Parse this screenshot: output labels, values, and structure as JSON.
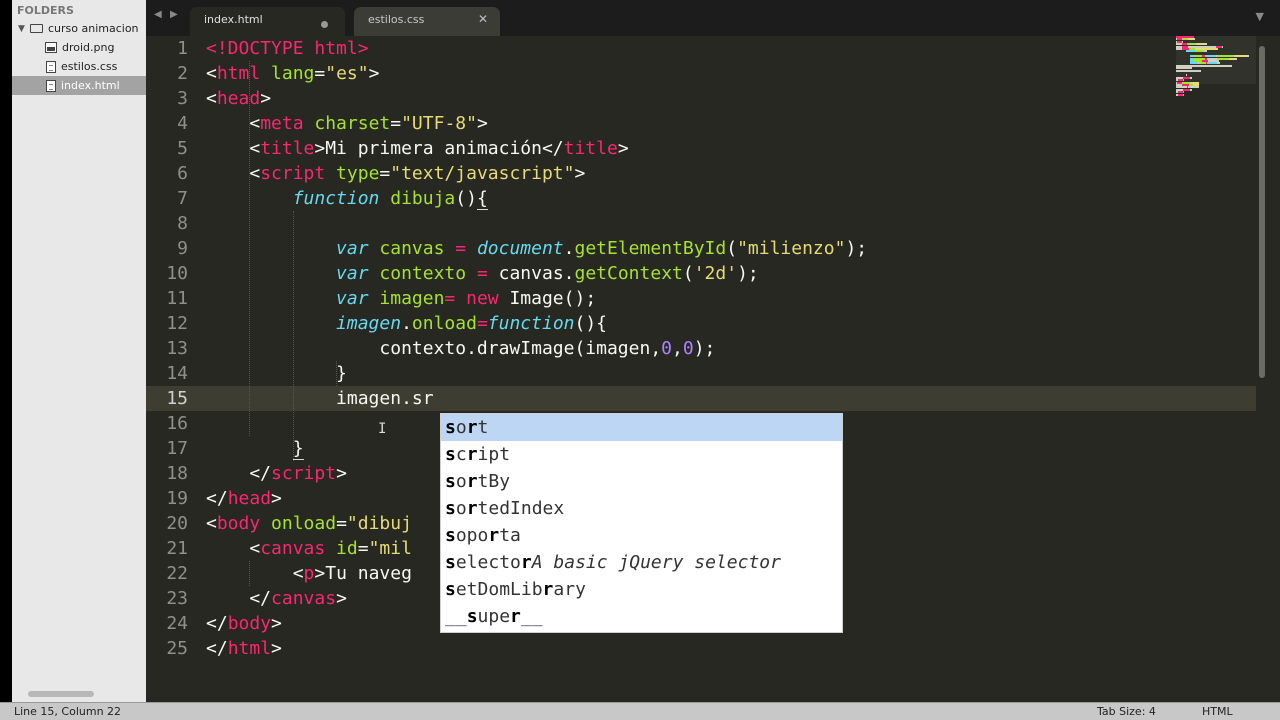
{
  "sidebar": {
    "header": "FOLDERS",
    "folder": {
      "name": "curso animacion",
      "icon": "folder-icon"
    },
    "files": [
      {
        "name": "droid.png",
        "icon": "image-file-icon",
        "selected": false
      },
      {
        "name": "estilos.css",
        "icon": "file-icon",
        "selected": false
      },
      {
        "name": "index.html",
        "icon": "file-icon",
        "selected": true
      }
    ]
  },
  "tabs": [
    {
      "label": "index.html",
      "active": true,
      "modified": true
    },
    {
      "label": "estilos.css",
      "active": false,
      "modified": false
    }
  ],
  "tabbar": {
    "nav_left_icon": "chevron-left-icon",
    "nav_right_icon": "chevron-right-icon",
    "menu_icon": "chevron-down-icon"
  },
  "editor": {
    "current_line": 15,
    "line_numbers": [
      "1",
      "2",
      "3",
      "4",
      "5",
      "6",
      "7",
      "8",
      "9",
      "10",
      "11",
      "12",
      "13",
      "14",
      "15",
      "16",
      "17",
      "18",
      "19",
      "20",
      "21",
      "22",
      "23",
      "24",
      "25"
    ],
    "lines": [
      [
        [
          "t-tag",
          "<!DOCTYPE html>"
        ]
      ],
      [
        [
          "",
          "<"
        ],
        [
          "t-tag",
          "html"
        ],
        [
          "t-attr",
          " lang"
        ],
        [
          "",
          "="
        ],
        [
          "t-str",
          "\"es\""
        ],
        [
          "",
          ">"
        ]
      ],
      [
        [
          "",
          "<"
        ],
        [
          "t-tag",
          "head"
        ],
        [
          "",
          ">"
        ]
      ],
      [
        [
          "",
          "    <"
        ],
        [
          "t-tag",
          "meta"
        ],
        [
          "t-attr",
          " charset"
        ],
        [
          "",
          "="
        ],
        [
          "t-str",
          "\"UTF-8\""
        ],
        [
          "",
          ">"
        ]
      ],
      [
        [
          "",
          "    <"
        ],
        [
          "t-tag",
          "title"
        ],
        [
          "",
          ">Mi primera animación</"
        ],
        [
          "t-tag",
          "title"
        ],
        [
          "",
          ">"
        ]
      ],
      [
        [
          "",
          "    <"
        ],
        [
          "t-tag",
          "script"
        ],
        [
          "t-attr",
          " type"
        ],
        [
          "",
          "="
        ],
        [
          "t-str",
          "\"text/javascript\""
        ],
        [
          "",
          ">"
        ]
      ],
      [
        [
          "",
          "        "
        ],
        [
          "t-kw",
          "function"
        ],
        [
          "t-fn",
          " dibuja"
        ],
        [
          "",
          "()"
        ],
        [
          "ul",
          "{"
        ]
      ],
      [
        [
          "",
          ""
        ]
      ],
      [
        [
          "",
          "            "
        ],
        [
          "t-kw",
          "var"
        ],
        [
          "t-fn",
          " canvas"
        ],
        [
          "t-kwn",
          " ="
        ],
        [
          "t-obj",
          " document"
        ],
        [
          "",
          "."
        ],
        [
          "t-fn",
          "getElementById"
        ],
        [
          "",
          "("
        ],
        [
          "t-str",
          "\"milienzo\""
        ],
        [
          "",
          ");"
        ]
      ],
      [
        [
          "",
          "            "
        ],
        [
          "t-kw",
          "var"
        ],
        [
          "t-fn",
          " contexto"
        ],
        [
          "t-kwn",
          " ="
        ],
        [
          "",
          " canvas."
        ],
        [
          "t-fn",
          "getContext"
        ],
        [
          "",
          "("
        ],
        [
          "t-str",
          "'2d'"
        ],
        [
          "",
          ");"
        ]
      ],
      [
        [
          "",
          "            "
        ],
        [
          "t-kw",
          "var"
        ],
        [
          "t-fn",
          " imagen"
        ],
        [
          "t-kwn",
          "="
        ],
        [
          "t-kwn",
          " new"
        ],
        [
          "",
          " Image();"
        ]
      ],
      [
        [
          "",
          "            "
        ],
        [
          "t-obj",
          "imagen"
        ],
        [
          "",
          "."
        ],
        [
          "t-fn",
          "onload"
        ],
        [
          "t-kwn",
          "="
        ],
        [
          "t-kw",
          "function"
        ],
        [
          "",
          "(){"
        ]
      ],
      [
        [
          "",
          "                contexto.drawImage(imagen,"
        ],
        [
          "t-num",
          "0"
        ],
        [
          "",
          ","
        ],
        [
          "t-num",
          "0"
        ],
        [
          "",
          ");"
        ]
      ],
      [
        [
          "",
          "            }"
        ]
      ],
      [
        [
          "",
          "            imagen.sr"
        ]
      ],
      [
        [
          "",
          ""
        ]
      ],
      [
        [
          "",
          "        "
        ],
        [
          "ul",
          "}"
        ]
      ],
      [
        [
          "",
          "    </"
        ],
        [
          "t-tag",
          "script"
        ],
        [
          "",
          ">"
        ]
      ],
      [
        [
          "",
          "</"
        ],
        [
          "t-tag",
          "head"
        ],
        [
          "",
          ">"
        ]
      ],
      [
        [
          "",
          "<"
        ],
        [
          "t-tag",
          "body"
        ],
        [
          "t-attr",
          " onload"
        ],
        [
          "",
          "="
        ],
        [
          "t-str",
          "\"dibuj"
        ]
      ],
      [
        [
          "",
          "    <"
        ],
        [
          "t-tag",
          "canvas"
        ],
        [
          "t-attr",
          " id"
        ],
        [
          "",
          "="
        ],
        [
          "t-str",
          "\"mil"
        ]
      ],
      [
        [
          "",
          "        <"
        ],
        [
          "t-tag",
          "p"
        ],
        [
          "",
          ">Tu naveg"
        ]
      ],
      [
        [
          "",
          "    </"
        ],
        [
          "t-tag",
          "canvas"
        ],
        [
          "",
          ">"
        ]
      ],
      [
        [
          "",
          "</"
        ],
        [
          "t-tag",
          "body"
        ],
        [
          "",
          ">"
        ]
      ],
      [
        [
          "",
          "</"
        ],
        [
          "t-tag",
          "html"
        ],
        [
          "",
          ">"
        ]
      ]
    ]
  },
  "autocomplete": {
    "selected_index": 0,
    "items": [
      [
        [
          "b",
          "s"
        ],
        [
          "",
          "o"
        ],
        [
          "b",
          "r"
        ],
        [
          "",
          "t"
        ]
      ],
      [
        [
          "b",
          "s"
        ],
        [
          "",
          "c"
        ],
        [
          "b",
          "r"
        ],
        [
          "",
          "ipt"
        ]
      ],
      [
        [
          "b",
          "s"
        ],
        [
          "",
          "o"
        ],
        [
          "b",
          "r"
        ],
        [
          "",
          "tBy"
        ]
      ],
      [
        [
          "b",
          "s"
        ],
        [
          "",
          "o"
        ],
        [
          "b",
          "r"
        ],
        [
          "",
          "tedIndex"
        ]
      ],
      [
        [
          "b",
          "s"
        ],
        [
          "",
          "opo"
        ],
        [
          "b",
          "r"
        ],
        [
          "",
          "ta"
        ]
      ],
      [
        [
          "b",
          "s"
        ],
        [
          "",
          "electo"
        ],
        [
          "b",
          "r"
        ],
        [
          "i",
          "A basic jQuery selector"
        ]
      ],
      [
        [
          "b",
          "s"
        ],
        [
          "",
          "etDomLib"
        ],
        [
          "b",
          "r"
        ],
        [
          "",
          "ary"
        ]
      ],
      [
        [
          "",
          "__"
        ],
        [
          "b",
          "s"
        ],
        [
          "",
          "upe"
        ],
        [
          "b",
          "r"
        ],
        [
          "",
          "__"
        ]
      ]
    ]
  },
  "status": {
    "position": "Line 15, Column 22",
    "tab_size": "Tab Size: 4",
    "syntax": "HTML"
  },
  "colors": {
    "editor_bg": "#272822",
    "tag": "#f92672",
    "attribute": "#a6e22e",
    "string": "#e6db74",
    "keyword": "#66d9ef",
    "number": "#ae81ff"
  }
}
